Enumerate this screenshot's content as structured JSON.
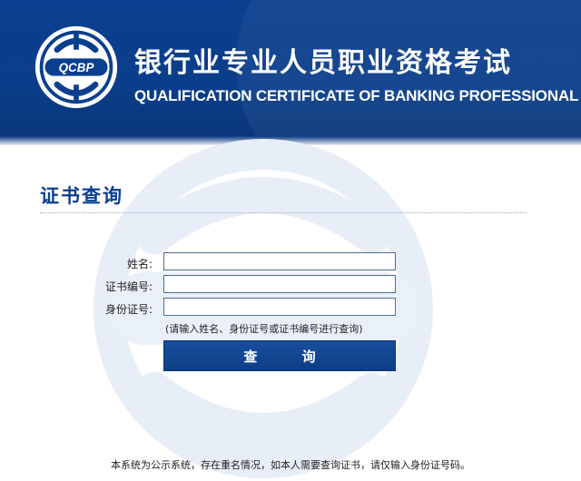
{
  "header": {
    "title_cn": "银行业专业人员职业资格考试",
    "title_en": "QUALIFICATION CERTIFICATE OF BANKING PROFESSIONAL",
    "logo_text": "QCBP",
    "logo_icon": "qcbp-logo-icon",
    "background_color": "#0a3f8f"
  },
  "page": {
    "section_title": "证书查询"
  },
  "form": {
    "name_label": "姓名:",
    "name_value": "",
    "cert_no_label": "证书编号:",
    "cert_no_value": "",
    "id_no_label": "身份证号:",
    "id_no_value": "",
    "hint": "(请输入姓名、身份证号或证书编号进行查询)",
    "submit_label": "查 询"
  },
  "footer": {
    "note": "本系统为公示系统，存在重名情况，如本人需要查询证书，请仅输入身份证号码。"
  },
  "colors": {
    "accent": "#0a3f8f",
    "input_border": "#4f6c99"
  }
}
